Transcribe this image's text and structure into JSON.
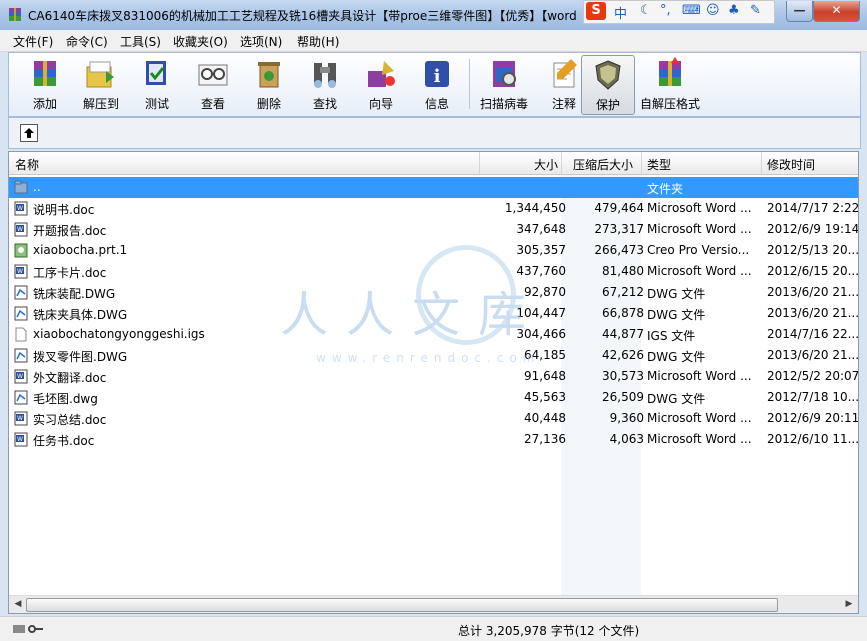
{
  "window": {
    "title": "CA6140车床拨叉831006的机械加工工艺规程及铣16槽夹具设计【带proe三维零件图】【优秀】【word",
    "minimize_label": "—",
    "close_label": "✕"
  },
  "ime": {
    "logo": "S",
    "mode": "中"
  },
  "menu": [
    "文件(F)",
    "命令(C)",
    "工具(S)",
    "收藏夹(O)",
    "选项(N)",
    "帮助(H)"
  ],
  "toolbar": [
    {
      "label": "添加",
      "icon": "add-icon"
    },
    {
      "label": "解压到",
      "icon": "extract-icon"
    },
    {
      "label": "测试",
      "icon": "test-icon"
    },
    {
      "label": "查看",
      "icon": "view-icon"
    },
    {
      "label": "删除",
      "icon": "delete-icon"
    },
    {
      "label": "查找",
      "icon": "find-icon"
    },
    {
      "label": "向导",
      "icon": "wizard-icon"
    },
    {
      "label": "信息",
      "icon": "info-icon"
    },
    {
      "label": "扫描病毒",
      "icon": "scan-virus-icon"
    },
    {
      "label": "注释",
      "icon": "comment-icon"
    },
    {
      "label": "保护",
      "icon": "protect-icon"
    },
    {
      "label": "自解压格式",
      "icon": "sfx-icon"
    }
  ],
  "columns": {
    "name": "名称",
    "size": "大小",
    "packed": "压缩后大小",
    "type": "类型",
    "modified": "修改时间"
  },
  "files": [
    {
      "name": "..",
      "size": "",
      "packed": "",
      "type": "文件夹",
      "modified": "",
      "icon": "folder",
      "selected": true
    },
    {
      "name": "说明书.doc",
      "size": "1,344,450",
      "packed": "479,464",
      "type": "Microsoft Word ...",
      "modified": "2014/7/17 2:22",
      "icon": "word"
    },
    {
      "name": "开题报告.doc",
      "size": "347,648",
      "packed": "273,317",
      "type": "Microsoft Word ...",
      "modified": "2012/6/9 19:14",
      "icon": "word"
    },
    {
      "name": "xiaobocha.prt.1",
      "size": "305,357",
      "packed": "266,473",
      "type": "Creo Pro Versio...",
      "modified": "2012/5/13 20...",
      "icon": "creo"
    },
    {
      "name": "工序卡片.doc",
      "size": "437,760",
      "packed": "81,480",
      "type": "Microsoft Word ...",
      "modified": "2012/6/15 20...",
      "icon": "word"
    },
    {
      "name": "铣床装配.DWG",
      "size": "92,870",
      "packed": "67,212",
      "type": "DWG 文件",
      "modified": "2013/6/20 21...",
      "icon": "dwg"
    },
    {
      "name": "铣床夹具体.DWG",
      "size": "104,447",
      "packed": "66,878",
      "type": "DWG 文件",
      "modified": "2013/6/20 21...",
      "icon": "dwg"
    },
    {
      "name": "xiaobochatongyonggeshi.igs",
      "size": "304,466",
      "packed": "44,877",
      "type": "IGS 文件",
      "modified": "2014/7/16 22...",
      "icon": "blank"
    },
    {
      "name": "拨叉零件图.DWG",
      "size": "64,185",
      "packed": "42,626",
      "type": "DWG 文件",
      "modified": "2013/6/20 21...",
      "icon": "dwg"
    },
    {
      "name": "外文翻译.doc",
      "size": "91,648",
      "packed": "30,573",
      "type": "Microsoft Word ...",
      "modified": "2012/5/2 20:07",
      "icon": "word"
    },
    {
      "name": "毛坯图.dwg",
      "size": "45,563",
      "packed": "26,509",
      "type": "DWG 文件",
      "modified": "2012/7/18 10...",
      "icon": "dwg"
    },
    {
      "name": "实习总结.doc",
      "size": "40,448",
      "packed": "9,360",
      "type": "Microsoft Word ...",
      "modified": "2012/6/9 20:11",
      "icon": "word"
    },
    {
      "name": "任务书.doc",
      "size": "27,136",
      "packed": "4,063",
      "type": "Microsoft Word ...",
      "modified": "2012/6/10 11...",
      "icon": "word"
    }
  ],
  "status": "总计 3,205,978 字节(12 个文件)",
  "watermark": {
    "text": "人人文库",
    "url": "www.renrendoc.com"
  },
  "colors": {
    "selection": "#3399ff",
    "titlebar": "#aac5e6",
    "close": "#c7412a"
  }
}
